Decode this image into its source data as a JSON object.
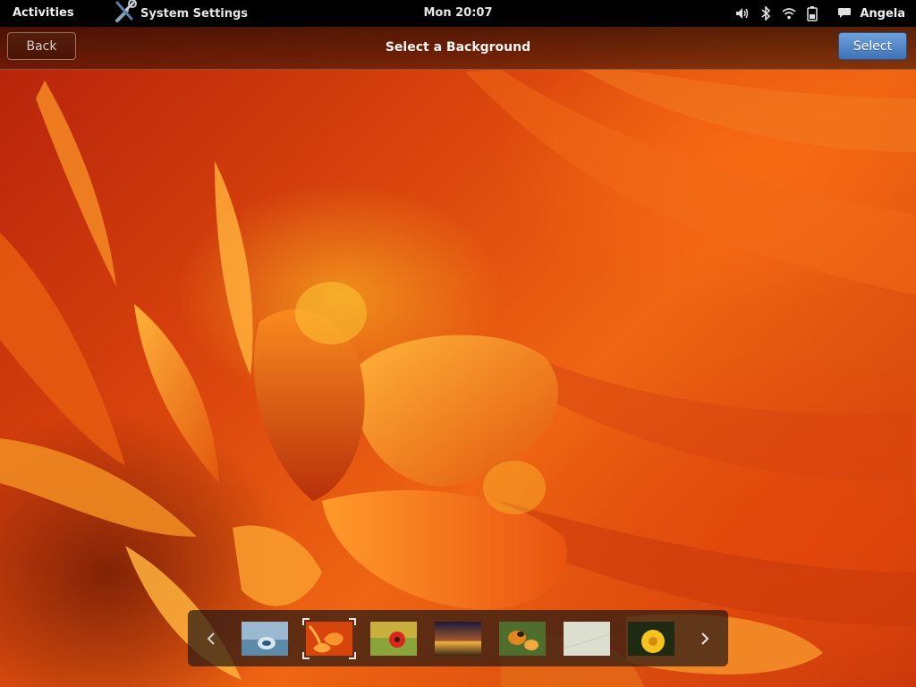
{
  "topbar": {
    "activities_label": "Activities",
    "app_name": "System Settings",
    "clock": "Mon 20:07",
    "user_name": "Angela",
    "icons": [
      "volume-icon",
      "bluetooth-icon",
      "wifi-icon",
      "battery-icon",
      "chat-icon"
    ]
  },
  "header": {
    "title": "Select a Background",
    "back_label": "Back",
    "select_label": "Select"
  },
  "thumbnails": {
    "selected_index": 1,
    "items": [
      {
        "name": "water-drop"
      },
      {
        "name": "orange-flower"
      },
      {
        "name": "red-flower"
      },
      {
        "name": "sunset-horizon"
      },
      {
        "name": "bee-flower"
      },
      {
        "name": "paper-texture"
      },
      {
        "name": "yellow-flower"
      }
    ]
  },
  "colors": {
    "select_button": "#4a80c4",
    "topbar_bg": "#000000"
  }
}
